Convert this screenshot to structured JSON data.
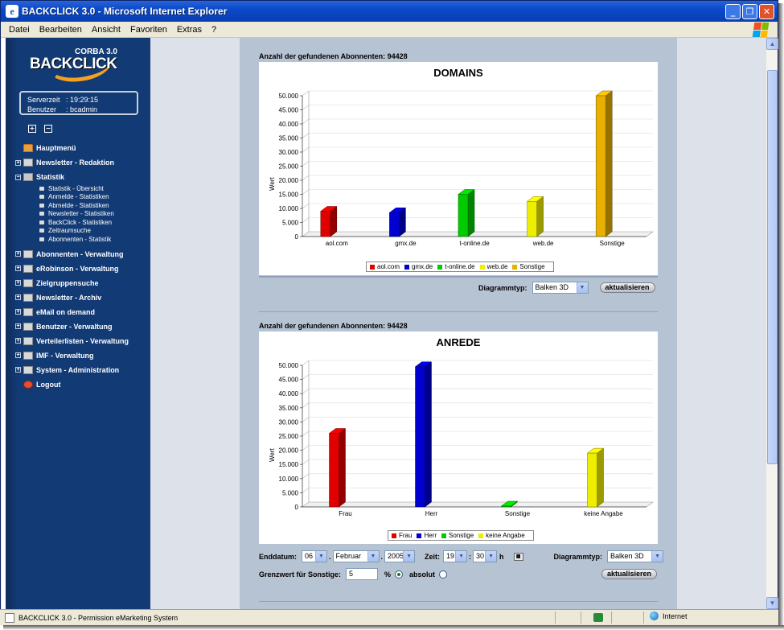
{
  "window": {
    "title": "BACKCLICK 3.0 - Microsoft Internet Explorer",
    "ie_icon": "ie-icon",
    "buttons": {
      "minimize": "_",
      "maximize": "❐",
      "close": "✕"
    }
  },
  "menubar": {
    "items": [
      "Datei",
      "Bearbeiten",
      "Ansicht",
      "Favoriten",
      "Extras",
      "?"
    ]
  },
  "sidebar": {
    "logo_top": "CORBA 3.0",
    "logo_brand": "BACKCLICK",
    "server": {
      "time_label": "Serverzeit",
      "time_value": ": 19:29:15",
      "user_label": "Benutzer",
      "user_value": ": bcadmin"
    },
    "expand_all": "+",
    "collapse_all": "−",
    "items": [
      {
        "label": "Hauptmenü",
        "icon": "home-icon"
      },
      {
        "label": "Newsletter - Redaktion",
        "icon": "folder-icon"
      },
      {
        "label": "Statistik",
        "icon": "stats-icon"
      },
      {
        "label": "Abonnenten - Verwaltung",
        "icon": "folder-icon"
      },
      {
        "label": "eRobinson - Verwaltung",
        "icon": "folder-icon"
      },
      {
        "label": "Zielgruppensuche",
        "icon": "folder-icon"
      },
      {
        "label": "Newsletter - Archiv",
        "icon": "folder-icon"
      },
      {
        "label": "eMail on demand",
        "icon": "folder-icon"
      },
      {
        "label": "Benutzer - Verwaltung",
        "icon": "folder-icon"
      },
      {
        "label": "Verteilerlisten - Verwaltung",
        "icon": "folder-icon"
      },
      {
        "label": "IMF - Verwaltung",
        "icon": "folder-icon"
      },
      {
        "label": "System - Administration",
        "icon": "folder-icon"
      },
      {
        "label": "Logout",
        "icon": "logout-icon"
      }
    ],
    "stat_sub": [
      "Statistik - Übersicht",
      "Anmelde - Statistiken",
      "Abmelde - Statistiken",
      "Newsletter - Statistiken",
      "BackClick - Statistiken",
      "Zeitraumsuche",
      "Abonnenten - Statistik"
    ]
  },
  "domains_section": {
    "found_text": "Anzahl der gefundenen Abonnenten:  94428",
    "diagrammtyp_label": "Diagrammtyp:",
    "diagrammtyp_value": "Balken 3D",
    "update_button": "aktualisieren"
  },
  "anrede_section": {
    "found_text": "Anzahl der gefundenen Abonnenten:  94428",
    "enddatum_label": "Enddatum:",
    "day": "06",
    "month": "Februar",
    "year": "2005",
    "zeit_label": "Zeit:",
    "hour": "19",
    "minute": "30",
    "h_label": "h",
    "diagrammtyp_label": "Diagrammtyp:",
    "diagrammtyp_value": "Balken 3D",
    "grenzwert_label": "Grenzwert für Sonstige:",
    "grenzwert_value": "5",
    "percent_label": "%",
    "absolut_label": "absolut",
    "update_button": "aktualisieren"
  },
  "statusbar": {
    "text": "BACKCLICK 3.0 - Permission eMarketing System",
    "zone": "Internet"
  },
  "chart_data": [
    {
      "type": "bar",
      "title": "DOMAINS",
      "ylabel": "Wert",
      "categories": [
        "aol.com",
        "gmx.de",
        "t-online.de",
        "web.de",
        "Sonstige"
      ],
      "values": [
        9000,
        8500,
        15000,
        12500,
        50000
      ],
      "colors": [
        "#e00000",
        "#0000d0",
        "#00cc00",
        "#eeee00",
        "#e8b000"
      ],
      "ylim": [
        0,
        50000
      ],
      "yticks": [
        "0",
        "5.000",
        "10.000",
        "15.000",
        "20.000",
        "25.000",
        "30.000",
        "35.000",
        "40.000",
        "45.000",
        "50.000"
      ],
      "legend": [
        "aol.com",
        "gmx.de",
        "t-online.de",
        "web.de",
        "Sonstige"
      ]
    },
    {
      "type": "bar",
      "title": "ANREDE",
      "ylabel": "Wert",
      "categories": [
        "Frau",
        "Herr",
        "Sonstige",
        "keine Angabe"
      ],
      "values": [
        26000,
        49500,
        300,
        19000
      ],
      "colors": [
        "#e00000",
        "#0000d0",
        "#00cc00",
        "#eeee00"
      ],
      "ylim": [
        0,
        50000
      ],
      "yticks": [
        "0",
        "5.000",
        "10.000",
        "15.000",
        "20.000",
        "25.000",
        "30.000",
        "35.000",
        "40.000",
        "45.000",
        "50.000"
      ],
      "legend": [
        "Frau",
        "Herr",
        "Sonstige",
        "keine Angabe"
      ]
    }
  ]
}
